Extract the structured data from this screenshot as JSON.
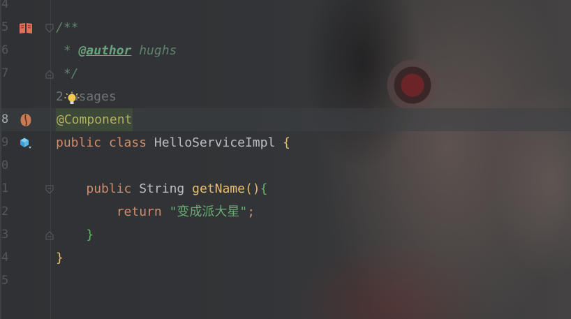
{
  "gutter": {
    "line_numbers": [
      "4",
      "5",
      "6",
      "7",
      "",
      "8",
      "9",
      "0",
      "1",
      "2",
      "3",
      "4",
      "5"
    ]
  },
  "code": {
    "line5_comment_open": "/**",
    "line6_star": " * ",
    "line6_tag": "@author",
    "line6_author": " hughs",
    "line7_comment_close": " */",
    "usages_hint": "2 usages",
    "line8_annotation": "@Component",
    "line9_kw_public": "public",
    "line9_kw_class": "class",
    "line9_classname": "HelloServiceImpl",
    "line9_brace": "{",
    "line11_kw_public": "public",
    "line11_type": "String",
    "line11_method": "getName",
    "line11_parens": "()",
    "line11_brace": "{",
    "line12_kw_return": "return",
    "line12_string": "\"变成派大星\"",
    "line12_semicolon": ";",
    "line13_brace": "}",
    "line14_brace": "}"
  },
  "icons": {
    "line5": "book-icon",
    "line8": "bean-icon",
    "line9": "implementation-icon",
    "hint": "lightbulb-icon"
  }
}
